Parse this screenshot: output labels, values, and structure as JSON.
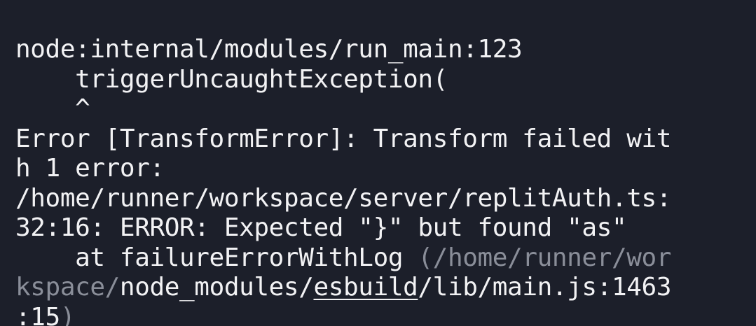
{
  "terminal": {
    "colors": {
      "background": "#1c1f2a",
      "foreground": "#f2f2f4",
      "dim": "#8a8e99"
    },
    "lines": {
      "l1": "node:internal/modules/run_main:123",
      "l2": "    triggerUncaughtException(",
      "l3": "    ^",
      "l4": "Error [TransformError]: Transform failed wit",
      "l5": "h 1 error:",
      "l6": "/home/runner/workspace/server/replitAuth.ts:",
      "l7": "32:16: ERROR: Expected \"}\" but found \"as\"",
      "l8": {
        "at": "    at failureErrorWithLog ",
        "path_dim": "(/home/runner/wor"
      },
      "l9": {
        "path_dim": "kspace/",
        "path_a": "node_modules/",
        "path_link": "esbuild",
        "path_b": "/lib/main.js:1463"
      },
      "l10": {
        "loc": ":15",
        "paren_dim": ")"
      }
    }
  }
}
